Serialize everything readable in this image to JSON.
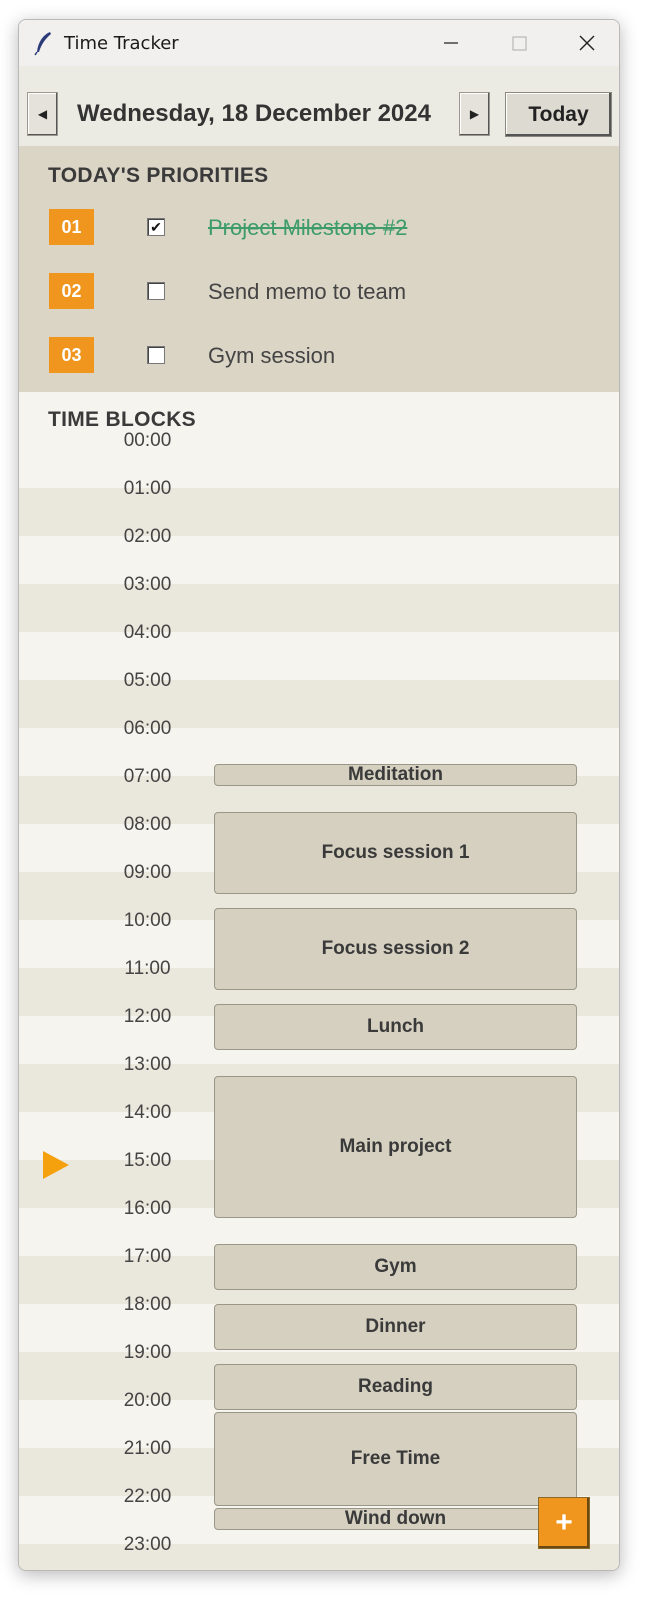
{
  "window": {
    "title": "Time Tracker"
  },
  "nav": {
    "prev_icon": "◀",
    "next_icon": "▶",
    "date": "Wednesday, 18 December 2024",
    "today_label": "Today"
  },
  "priorities": {
    "title": "TODAY'S PRIORITIES",
    "items": [
      {
        "num": "01",
        "label": "Project Milestone #2",
        "checked": true,
        "check_glyph": "✔"
      },
      {
        "num": "02",
        "label": "Send memo to team",
        "checked": false,
        "check_glyph": ""
      },
      {
        "num": "03",
        "label": "Gym session",
        "checked": false,
        "check_glyph": ""
      }
    ]
  },
  "time_blocks": {
    "title": "TIME BLOCKS",
    "hours": [
      "00:00",
      "01:00",
      "02:00",
      "03:00",
      "04:00",
      "05:00",
      "06:00",
      "07:00",
      "08:00",
      "09:00",
      "10:00",
      "11:00",
      "12:00",
      "13:00",
      "14:00",
      "15:00",
      "16:00",
      "17:00",
      "18:00",
      "19:00",
      "20:00",
      "21:00",
      "22:00",
      "23:00"
    ],
    "current_hour": "15:00",
    "blocks": [
      {
        "label": "Meditation",
        "start": "07:00",
        "end": "07:30"
      },
      {
        "label": "Focus session 1",
        "start": "08:00",
        "end": "09:45"
      },
      {
        "label": "Focus session 2",
        "start": "10:00",
        "end": "11:45"
      },
      {
        "label": "Lunch",
        "start": "12:00",
        "end": "13:00"
      },
      {
        "label": "Main project",
        "start": "13:30",
        "end": "16:30"
      },
      {
        "label": "Gym",
        "start": "17:00",
        "end": "18:00"
      },
      {
        "label": "Dinner",
        "start": "18:15",
        "end": "19:15"
      },
      {
        "label": "Reading",
        "start": "19:30",
        "end": "20:30"
      },
      {
        "label": "Free Time",
        "start": "20:30",
        "end": "22:30"
      },
      {
        "label": "Wind down",
        "start": "22:30",
        "end": "23:00"
      }
    ]
  },
  "add_button": {
    "label": "+"
  },
  "colors": {
    "accent": "#f0961e",
    "done_text": "#3e9c6a",
    "priority_bg": "#dbd5c6",
    "block_bg": "#d5d0c0"
  }
}
